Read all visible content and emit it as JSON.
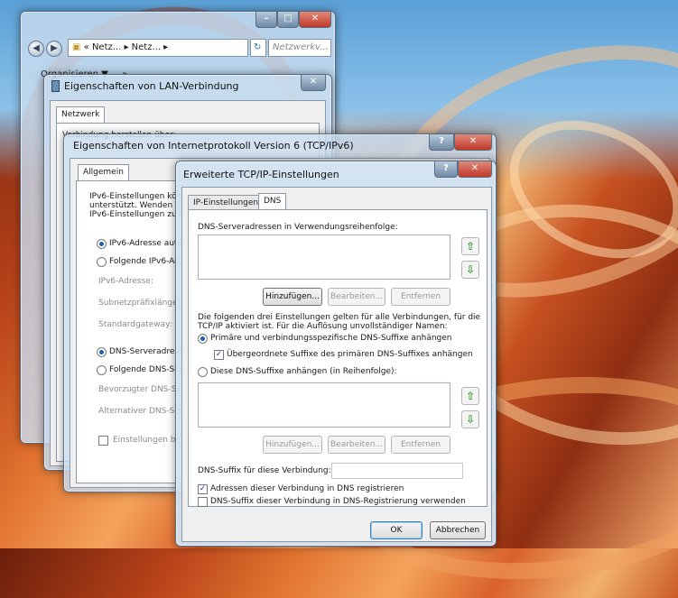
{
  "explorer": {
    "address": "« Netz... ▸ Netz... ▸",
    "search_placeholder": "Netzwerkv...",
    "toolbar_organize": "Organisieren ▼",
    "toolbar_more": "»",
    "refresh_glyph": "↻"
  },
  "lan_properties": {
    "title": "Eigenschaften von LAN-Verbindung",
    "tab_network": "Netzwerk",
    "connect_using": "Verbindung herstellen über:"
  },
  "ipv6_properties": {
    "title": "Eigenschaften von Internetprotokoll Version 6 (TCP/IPv6)",
    "tab_general": "Allgemein",
    "intro_line1": "IPv6-Einstellungen könn",
    "intro_line2": "unterstützt. Wenden Si",
    "intro_line3": "IPv6-Einstellungen zu b",
    "radio_auto_address": "IPv6-Adresse auto",
    "radio_manual_address": "Folgende IPv6-Ad",
    "label_ipv6_address": "IPv6-Adresse:",
    "label_prefix": "Subnetzpräfixlänge:",
    "label_gateway": "Standardgateway:",
    "radio_auto_dns": "DNS-Serveradress",
    "radio_manual_dns": "Folgende DNS-Ser",
    "label_preferred_dns": "Bevorzugter DNS-Se",
    "label_alternate_dns": "Alternativer DNS-Ser",
    "checkbox_validate": "Einstellungen bei",
    "help_glyph": "?",
    "close_glyph": "✕"
  },
  "advanced": {
    "title": "Erweiterte TCP/IP-Einstellungen",
    "help_glyph": "?",
    "close_glyph": "✕",
    "tab_ip_settings": "IP-Einstellungen",
    "tab_dns": "DNS",
    "dns_servers_label": "DNS-Serveradressen in Verwendungsreihenfolge:",
    "arrow_up": "⇧",
    "arrow_down": "⇩",
    "btn_add": "Hinzufügen...",
    "btn_edit": "Bearbeiten...",
    "btn_remove": "Entfernen",
    "info_line1": "Die folgenden drei Einstellungen gelten für alle Verbindungen, für die",
    "info_line2": "TCP/IP aktiviert ist. Für die Auflösung unvollständiger Namen:",
    "radio_primary_suffixes": "Primäre und verbindungsspezifische DNS-Suffixe anhängen",
    "checkbox_parent_suffixes": "Übergeordnete Suffixe des primären DNS-Suffixes anhängen",
    "radio_these_suffixes": "Diese DNS-Suffixe anhängen (in Reihenfolge):",
    "btn_add2": "Hinzufügen...",
    "btn_edit2": "Bearbeiten...",
    "btn_remove2": "Entfernen",
    "suffix_label": "DNS-Suffix für diese Verbindung:",
    "suffix_value": "",
    "checkbox_register": "Adressen dieser Verbindung in DNS registrieren",
    "checkbox_use_suffix": "DNS-Suffix dieser Verbindung in DNS-Registrierung verwenden",
    "checkmark": "✓",
    "btn_ok": "OK",
    "btn_cancel": "Abbrechen"
  }
}
